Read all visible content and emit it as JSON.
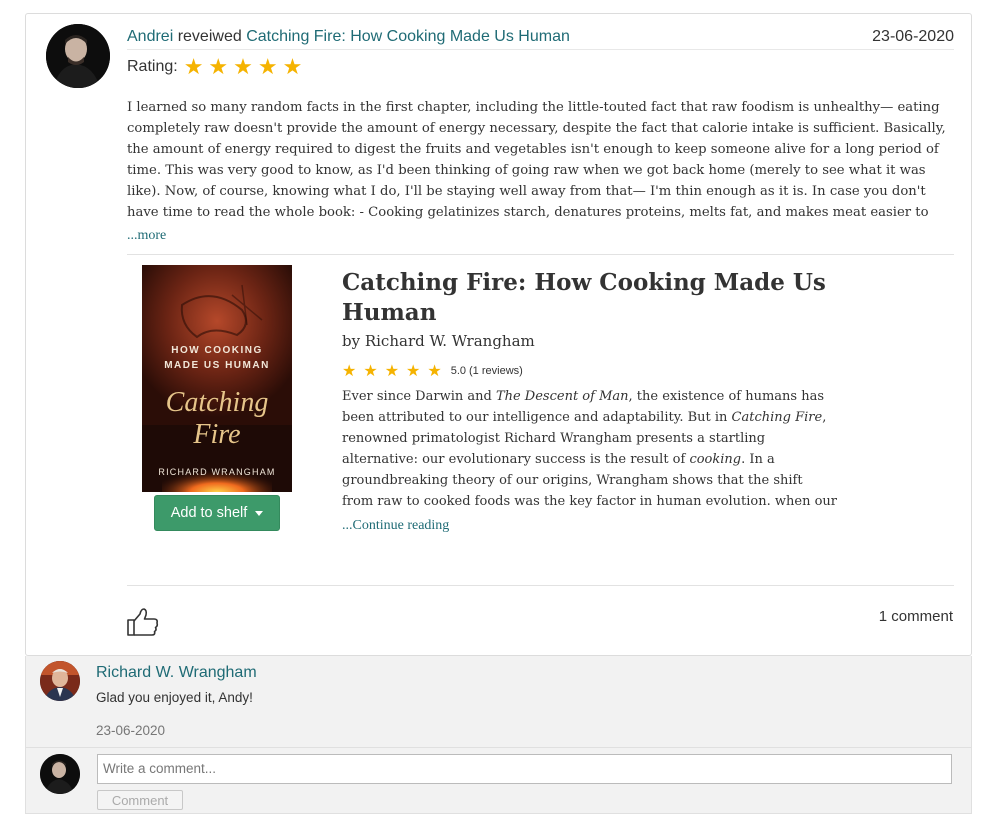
{
  "review": {
    "user": "Andrei",
    "verb": "reveiwed",
    "book_link": "Catching Fire: How Cooking Made Us Human",
    "date": "23-06-2020",
    "rating_label": "Rating:",
    "rating_value": 5,
    "rating_stars": "★★★★★",
    "text": "I learned so many random facts in the first chapter, including the little-touted fact that raw foodism is unhealthy— eating completely raw doesn't provide the amount of energy necessary, despite the fact that calorie intake is sufficient. Basically, the amount of energy required to digest the fruits and vegetables isn't enough to keep someone alive for a long period of time. This was very good to know, as I'd been thinking of going raw when we got back home (merely to see what it was like). Now, of course, knowing what I do, I'll be staying well away from that— I'm thin enough as it is. In case you don't have time to read the whole book: - Cooking gelatinizes starch, denatures proteins, melts fat, and makes meat easier to chew, all contributing to the extraordinarily short amount of time humans",
    "more_label": "...more"
  },
  "book": {
    "title": "Catching Fire: How Cooking Made Us Human",
    "author": "by Richard W. Wrangham",
    "stars": "★★★★★",
    "rating": "5.0",
    "reviews": "(1 reviews)",
    "desc_1": "Ever since Darwin and ",
    "desc_em1": "The Descent of Man",
    "desc_2": ", the existence of humans has been attributed to our intelligence and adaptability. But in ",
    "desc_em2": "Catching Fire",
    "desc_3": ", renowned primatologist Richard Wrangham presents a startling alternative: our evolutionary success is the result of ",
    "desc_em3": "cooking",
    "desc_4": ". In a groundbreaking theory of our origins, Wrangham shows that the shift from raw to cooked foods was the key factor in human evolution. when our ancestors adapted to using fire, humanity",
    "continue_label": "...Continue reading",
    "shelf_button": "Add to shelf",
    "cover": {
      "line1": "HOW COOKING",
      "line2": "MADE US HUMAN",
      "script1": "Catching",
      "script2": "Fire",
      "author": "RICHARD WRANGHAM"
    }
  },
  "footer": {
    "like_icon": "thumbs-up-icon",
    "comment_count": "1 comment"
  },
  "comments": [
    {
      "author": "Richard W. Wrangham",
      "text": "Glad you enjoyed it, Andy!",
      "date": "23-06-2020"
    }
  ],
  "new_comment": {
    "placeholder": "Write a comment...",
    "button": "Comment"
  },
  "colors": {
    "link": "#1f6b75",
    "star": "#f5b301",
    "shelf_button": "#3d9a6a"
  }
}
